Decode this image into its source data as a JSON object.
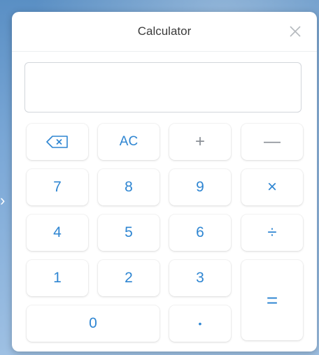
{
  "window": {
    "title": "Calculator"
  },
  "display": {
    "value": ""
  },
  "keys": {
    "backspace_icon": "backspace-icon",
    "clear": "AC",
    "plus": "+",
    "minus": "—",
    "seven": "7",
    "eight": "8",
    "nine": "9",
    "multiply": "×",
    "four": "4",
    "five": "5",
    "six": "6",
    "divide": "÷",
    "one": "1",
    "two": "2",
    "three": "3",
    "equals": "=",
    "zero": "0",
    "decimal": "•"
  },
  "colors": {
    "digit": "#2f86d2",
    "operator": "#8a8f96",
    "window_bg": "#ffffff"
  }
}
